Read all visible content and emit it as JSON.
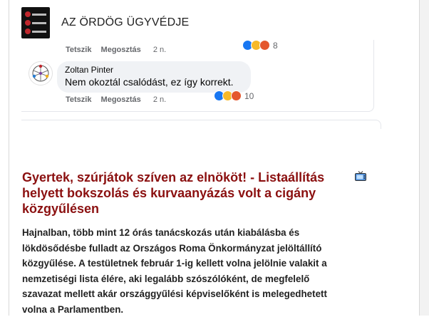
{
  "blog": {
    "title": "AZ ÖRDÖG ÜGYVÉDJE",
    "logo_icon": "blog-logo-icon"
  },
  "fb_embed": {
    "top_actions": {
      "like": "Tetszik",
      "share": "Megosztás",
      "age": "2 n.",
      "reaction_count": "8"
    },
    "comment": {
      "author": "Zoltan Pinter",
      "text": "Nem okoztál csalódást, ez így korrekt.",
      "reaction_count": "10",
      "like": "Tetszik",
      "share": "Megosztás",
      "age": "2 n."
    },
    "colors": {
      "like": "#1877f2",
      "haha": "#f7b928",
      "angry": "#e4572e"
    }
  },
  "article": {
    "title": "Gyertek, szúrjátok szíven az elnököt! - Listaállítás helyett bokszolás és kurvaanyázás volt a cigány közgyűlésen",
    "body_lines": [
      "Hajnalban, több mint 12 órás tanácskozás után kiabálásba és",
      "lökdösődésbe fulladt az Országos Roma Önkormányzat jelöltállító",
      "közgyűlése. A testületnek február 1-ig kellett volna jelölnie valakit a",
      "nemzetiségi lista élére, aki legalább szószólóként, de megfelelő",
      "szavazat mellett akár országgyűlési képviselőként is melegedhetett",
      "volna a Parlamentben."
    ],
    "title_color": "#8b1010",
    "video_icon": "tv-icon"
  }
}
